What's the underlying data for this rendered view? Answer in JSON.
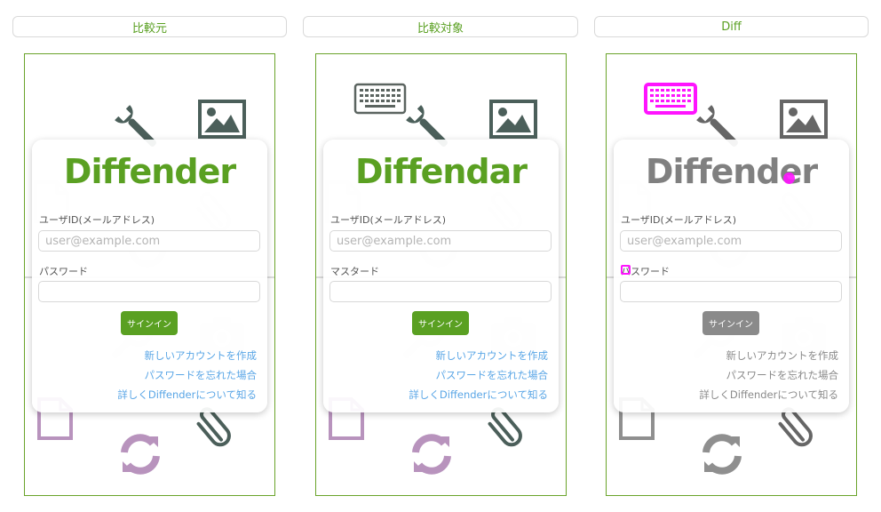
{
  "tabs": [
    "比較元",
    "比較対象",
    "Diff"
  ],
  "panels": [
    {
      "logo": "Diffender",
      "password_label": "パスワード"
    },
    {
      "logo": "Diffendar",
      "password_label": "マスタード"
    },
    {
      "logo": "Diffender",
      "password_label": "パスワード"
    }
  ],
  "form": {
    "user_label": "ユーザID(メールアドレス)",
    "user_placeholder": "user@example.com",
    "signin": "サインイン",
    "links": [
      "新しいアカウントを作成",
      "パスワードを忘れた場合",
      "詳しくDiffenderについて知る"
    ]
  },
  "colors": {
    "brand_green": "#5aa022",
    "link_blue": "#5aa6e6",
    "diff_magenta": "#ff14ff",
    "diff_gray": "#888888",
    "icon_dark": "#4b5f5a",
    "icon_purple": "#b893bd"
  },
  "icons": [
    "wrench-icon",
    "image-icon",
    "document-icon",
    "paperclip-icon",
    "refresh-icon",
    "camera-icon",
    "magnifier-icon",
    "keyboard-icon"
  ]
}
